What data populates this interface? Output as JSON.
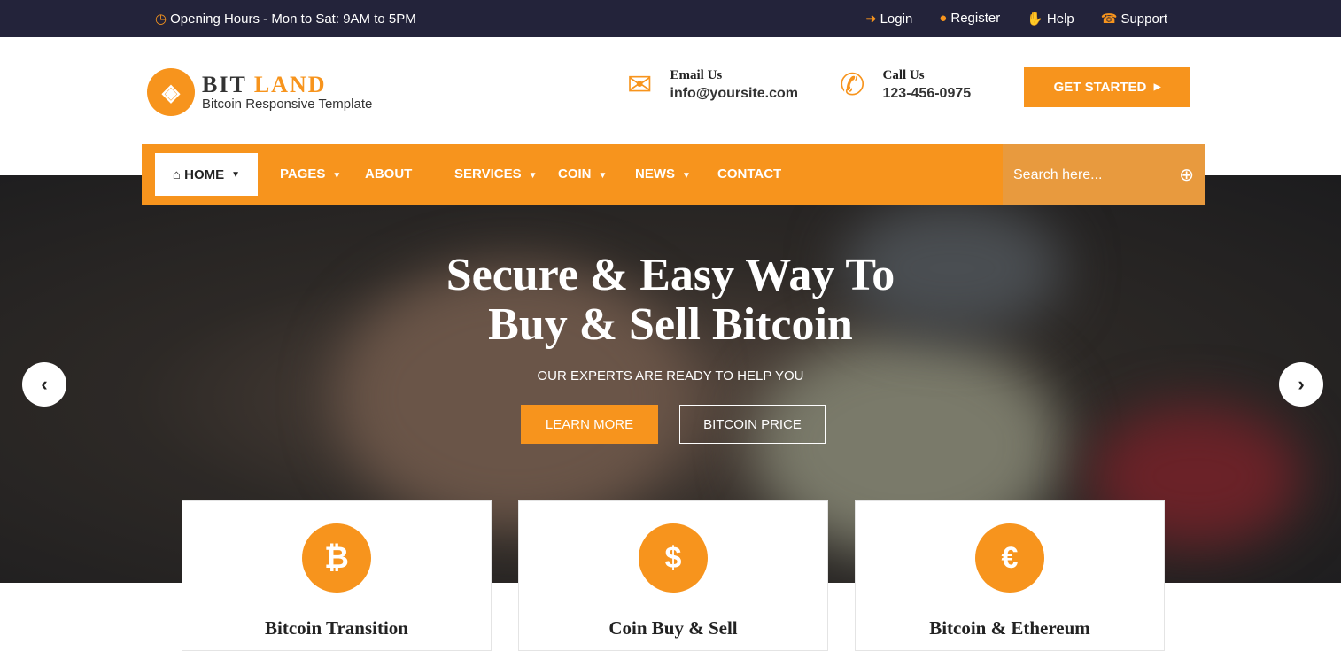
{
  "topbar": {
    "hours": "Opening Hours - Mon to Sat: 9AM to 5PM",
    "links": [
      {
        "label": "Login",
        "icon": "login-icon"
      },
      {
        "label": "Register",
        "icon": "user-icon"
      },
      {
        "label": "Help",
        "icon": "hand-icon"
      },
      {
        "label": "Support",
        "icon": "support-icon"
      }
    ]
  },
  "logo": {
    "brand_a": "BIT",
    "brand_b": "LAND",
    "tagline": "Bitcoin Responsive Template"
  },
  "contact": {
    "email_label": "Email Us",
    "email": "info@yoursite.com",
    "call_label": "Call Us",
    "phone": "123-456-0975"
  },
  "cta": "GET STARTED",
  "nav": {
    "home": "HOME",
    "items": [
      "PAGES",
      "ABOUT",
      "SERVICES",
      "COIN",
      "NEWS",
      "CONTACT"
    ],
    "search_placeholder": "Search here..."
  },
  "hero": {
    "title_line1": "Secure & Easy Way To",
    "title_line2": "Buy & Sell Bitcoin",
    "subtitle": "OUR EXPERTS ARE READY TO HELP YOU",
    "learn_more": "LEARN MORE",
    "bitcoin_price": "BITCOIN PRICE"
  },
  "cards": [
    {
      "symbol": "₿",
      "title": "Bitcoin Transition"
    },
    {
      "symbol": "$",
      "title": "Coin Buy & Sell"
    },
    {
      "symbol": "€",
      "title": "Bitcoin & Ethereum"
    }
  ],
  "colors": {
    "accent": "#f7941d",
    "topbar": "#23233a"
  }
}
